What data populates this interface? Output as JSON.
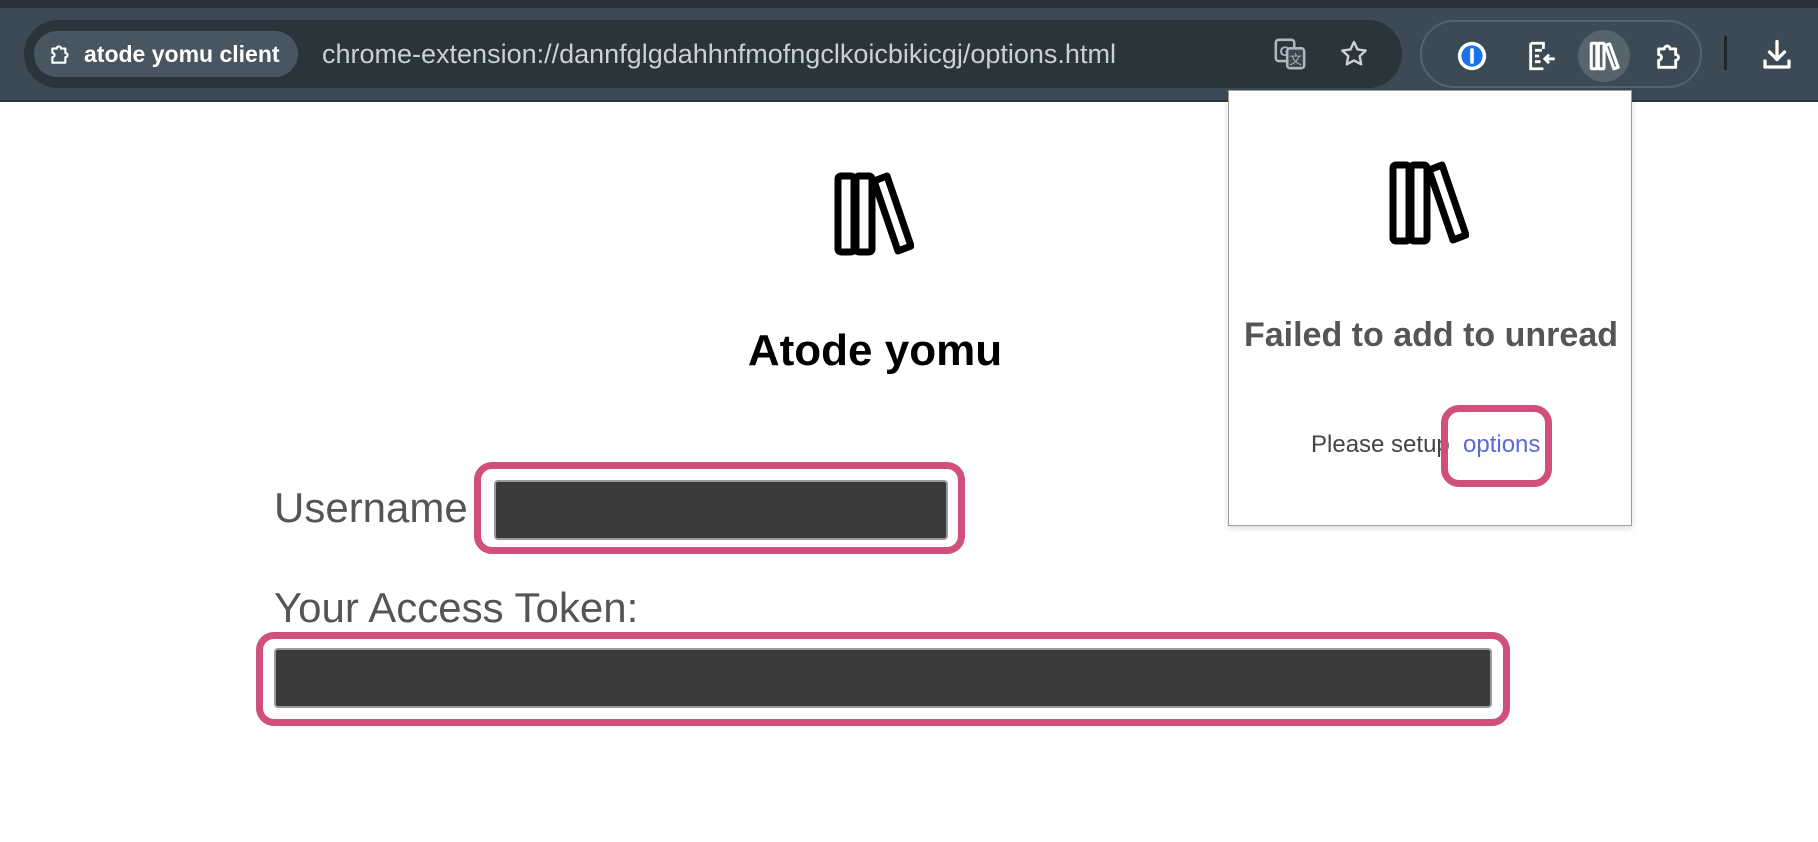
{
  "browser": {
    "site_chip_label": "atode yomu client",
    "url": "chrome-extension://dannfglgdahhnfmofngclkoicbikicgj/options.html",
    "icons": [
      "puzzle-icon",
      "translate-icon",
      "star-icon",
      "password-manager-icon",
      "reading-list-icon",
      "atode-yomu-extension-icon",
      "extensions-icon",
      "download-icon"
    ]
  },
  "page": {
    "title": "Atode yomu",
    "username_label": "Username",
    "username_value": "",
    "token_label": "Your Access Token:",
    "token_value": ""
  },
  "popup": {
    "title": "Failed to add to unread",
    "setup_text": "Please setup",
    "options_link": "options"
  },
  "colors": {
    "toolbar": "#3c4a55",
    "highlight": "#d04f7d",
    "link": "#5b6ad6",
    "input_bg": "#3b3b3b"
  }
}
